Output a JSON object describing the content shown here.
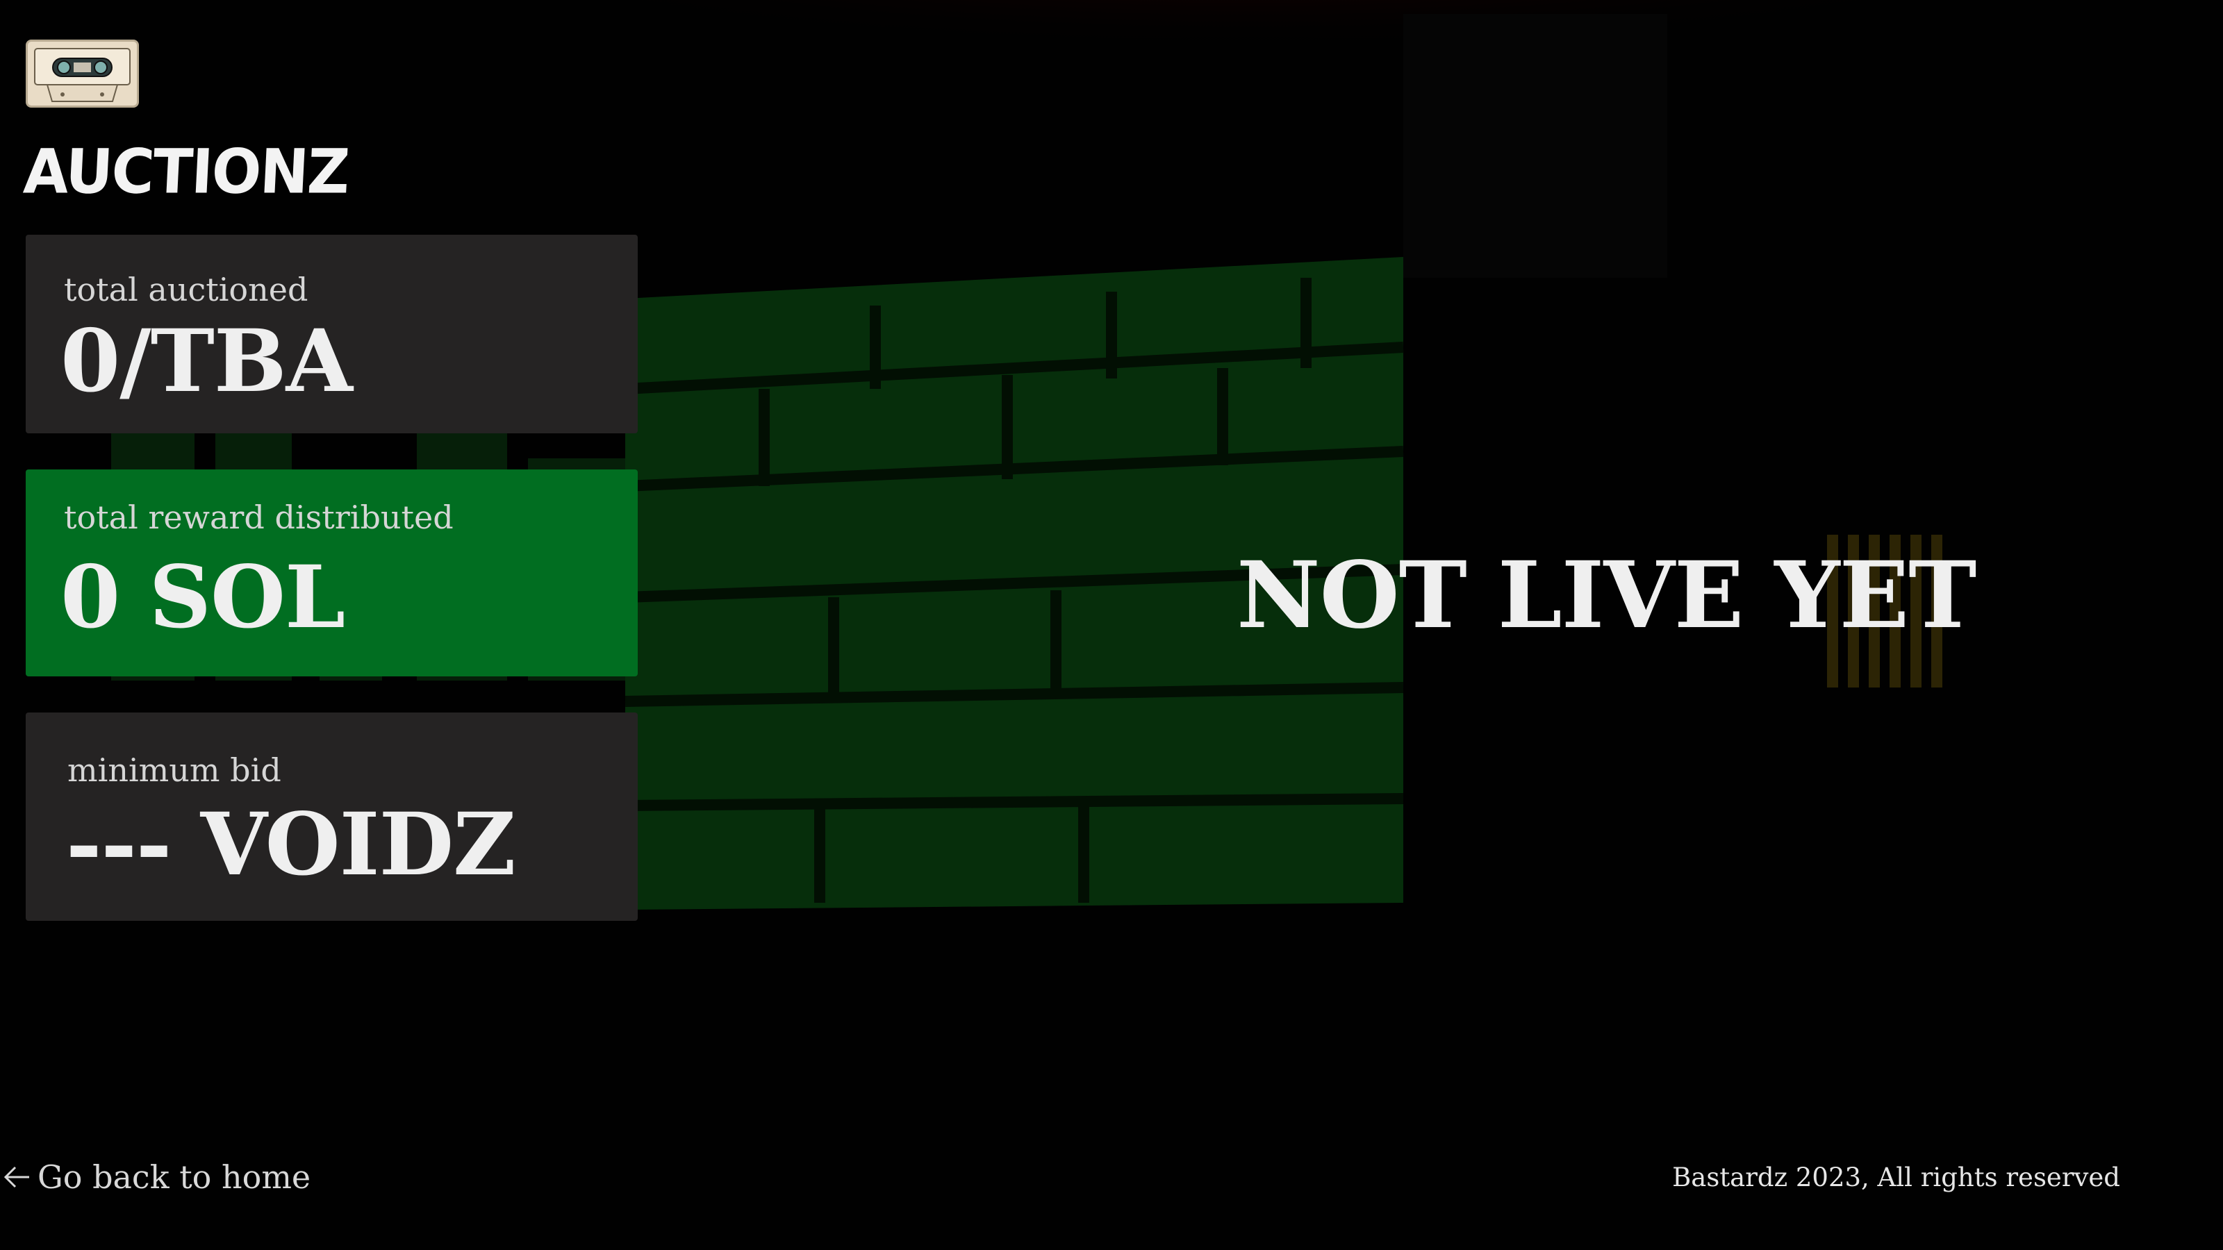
{
  "header": {
    "logo_icon": "cassette-tape-icon",
    "title": "AUCTIONZ"
  },
  "stats": {
    "total_auctioned": {
      "label": "total auctioned",
      "value": "0/TBA"
    },
    "total_reward": {
      "label": "total reward distributed",
      "value": "0 SOL"
    },
    "minimum_bid": {
      "label": "minimum bid",
      "value": "--- VOIDZ"
    }
  },
  "main": {
    "status": "NOT LIVE YET"
  },
  "footer": {
    "back_icon": "arrow-left-icon",
    "back_label": "Go back to home",
    "copyright": "Bastardz 2023, All rights reserved"
  },
  "colors": {
    "card_bg": "#252323",
    "accent_green": "#016e21",
    "page_bg": "#010101",
    "text": "#efefef"
  }
}
